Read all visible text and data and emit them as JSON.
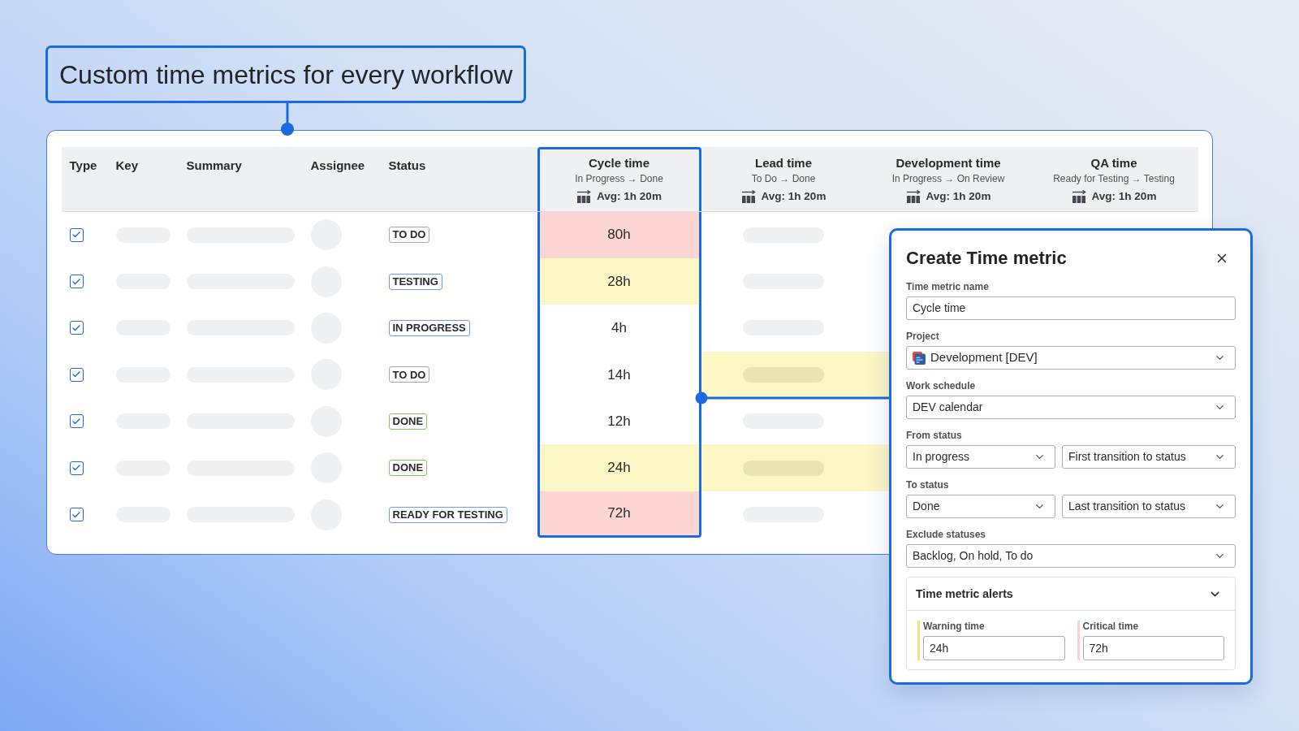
{
  "headline": "Custom time metrics for every workflow",
  "table": {
    "columns": [
      {
        "label": "Type"
      },
      {
        "label": "Key"
      },
      {
        "label": "Summary"
      },
      {
        "label": "Assignee"
      },
      {
        "label": "Status"
      }
    ],
    "metric_columns": [
      {
        "title": "Cycle time",
        "transition": "In Progress → Done",
        "average": "Avg: 1h 20m",
        "selected": true
      },
      {
        "title": "Lead time",
        "transition": "To Do → Done",
        "average": "Avg: 1h 20m",
        "selected": false
      },
      {
        "title": "Development time",
        "transition": "In Progress → On Review",
        "average": "Avg: 1h 20m",
        "selected": false
      },
      {
        "title": "QA time",
        "transition": "Ready for Testing → Testing",
        "average": "Avg: 1h 20m",
        "selected": false
      }
    ],
    "rows": [
      {
        "checked": true,
        "status": {
          "label": "TO DO",
          "color": "#a5a8ae"
        },
        "cells": [
          {
            "kind": "value",
            "value": "80h",
            "critical": true
          },
          {
            "kind": "placeholder",
            "warning": false,
            "critical": false
          },
          {
            "kind": "blank",
            "warning": false,
            "critical": false
          }
        ]
      },
      {
        "checked": true,
        "status": {
          "label": "TESTING",
          "color": "#6c9cf0"
        },
        "cells": [
          {
            "kind": "value",
            "value": "28h",
            "warning": true,
            "critical": false
          },
          {
            "kind": "placeholder",
            "warning": false,
            "critical": false
          },
          {
            "kind": "blank",
            "warning": false,
            "critical": false
          }
        ]
      },
      {
        "checked": true,
        "status": {
          "label": "IN PROGRESS",
          "color": "#6c9cf0"
        },
        "cells": [
          {
            "kind": "value",
            "value": "4h",
            "warning": false,
            "critical": false
          },
          {
            "kind": "placeholder",
            "warning": false,
            "critical": false
          },
          {
            "kind": "blank",
            "warning": false,
            "critical": false
          }
        ]
      },
      {
        "checked": true,
        "status": {
          "label": "TO DO",
          "color": "#a5a8ae"
        },
        "cells": [
          {
            "kind": "value",
            "value": "14h",
            "warning": false,
            "critical": false
          },
          {
            "kind": "placeholder",
            "warning": true,
            "critical": false
          },
          {
            "kind": "blank",
            "warning": true,
            "critical": false
          }
        ]
      },
      {
        "checked": true,
        "status": {
          "label": "DONE",
          "color": "#8cc45c"
        },
        "cells": [
          {
            "kind": "value",
            "value": "12h",
            "warning": false,
            "critical": false
          },
          {
            "kind": "placeholder",
            "warning": false,
            "critical": false
          },
          {
            "kind": "blank",
            "warning": false,
            "critical": false
          }
        ]
      },
      {
        "checked": true,
        "status": {
          "label": "DONE",
          "color": "#8cc45c"
        },
        "cells": [
          {
            "kind": "value",
            "value": "24h",
            "warning": true,
            "critical": false
          },
          {
            "kind": "placeholder",
            "warning": true,
            "critical": false
          },
          {
            "kind": "blank",
            "warning": true,
            "critical": false
          }
        ]
      },
      {
        "checked": true,
        "status": {
          "label": "READY FOR TESTING",
          "color": "#6c9cf0"
        },
        "cells": [
          {
            "kind": "value",
            "value": "72h",
            "critical": true
          },
          {
            "kind": "placeholder",
            "warning": false,
            "critical": false
          },
          {
            "kind": "blank",
            "warning": false,
            "critical": false
          }
        ]
      }
    ]
  },
  "dialog": {
    "title": "Create Time metric",
    "fields": [
      {
        "kind": "text",
        "label": "Time metric name",
        "value": "Cycle time"
      },
      {
        "kind": "project_select",
        "label": "Project",
        "value": "Development [DEV]"
      },
      {
        "kind": "select",
        "label": "Work schedule",
        "value": "DEV calendar"
      },
      {
        "kind": "select_pair",
        "label": "From status",
        "values": [
          "In progress",
          "First transition to status"
        ]
      },
      {
        "kind": "select_pair",
        "label": "To status",
        "values": [
          "Done",
          "Last transition to status"
        ]
      },
      {
        "kind": "select",
        "label": "Exclude statuses",
        "value": "Backlog, On hold, To do"
      }
    ],
    "alerts": {
      "title": "Time metric alerts",
      "expanded": true,
      "thresholds": [
        {
          "label": "Warning time",
          "value": "24h",
          "color": "#f5e27c"
        },
        {
          "label": "Critical time",
          "value": "72h",
          "color": "#fbd0cd"
        }
      ]
    }
  }
}
